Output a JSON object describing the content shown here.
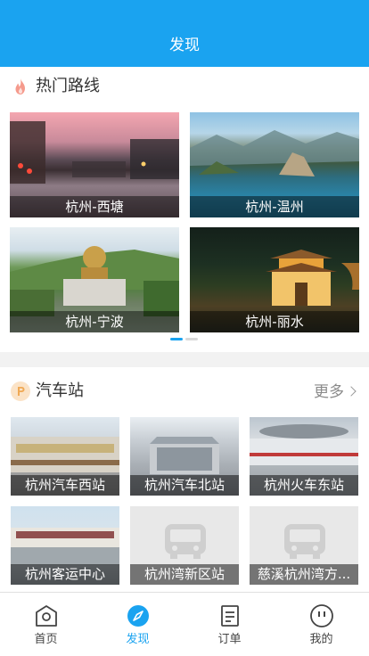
{
  "header": {
    "title": "发现"
  },
  "routes": {
    "title": "热门路线",
    "items": [
      {
        "label": "杭州-西塘"
      },
      {
        "label": "杭州-温州"
      },
      {
        "label": "杭州-宁波"
      },
      {
        "label": "杭州-丽水"
      }
    ],
    "carousel": {
      "pages": 2,
      "active_page": 1
    }
  },
  "stations": {
    "title": "汽车站",
    "more_label": "更多",
    "items": [
      {
        "label": "杭州汽车西站",
        "has_photo": true
      },
      {
        "label": "杭州汽车北站",
        "has_photo": true
      },
      {
        "label": "杭州火车东站",
        "has_photo": true
      },
      {
        "label": "杭州客运中心",
        "has_photo": true
      },
      {
        "label": "杭州湾新区站",
        "has_photo": false,
        "icon": "bus-placeholder-icon"
      },
      {
        "label": "慈溪杭州湾方...",
        "has_photo": false,
        "icon": "bus-placeholder-icon"
      }
    ]
  },
  "tabbar": {
    "items": [
      {
        "label": "首页",
        "icon": "home-icon",
        "active": false
      },
      {
        "label": "发现",
        "icon": "compass-icon",
        "active": true
      },
      {
        "label": "订单",
        "icon": "order-icon",
        "active": false
      },
      {
        "label": "我的",
        "icon": "profile-icon",
        "active": false
      }
    ]
  },
  "colors": {
    "accent": "#1aa3f0",
    "fire_icon": "#f59a8c",
    "station_icon": "#f7c58a",
    "inactive_tab": "#444444"
  }
}
